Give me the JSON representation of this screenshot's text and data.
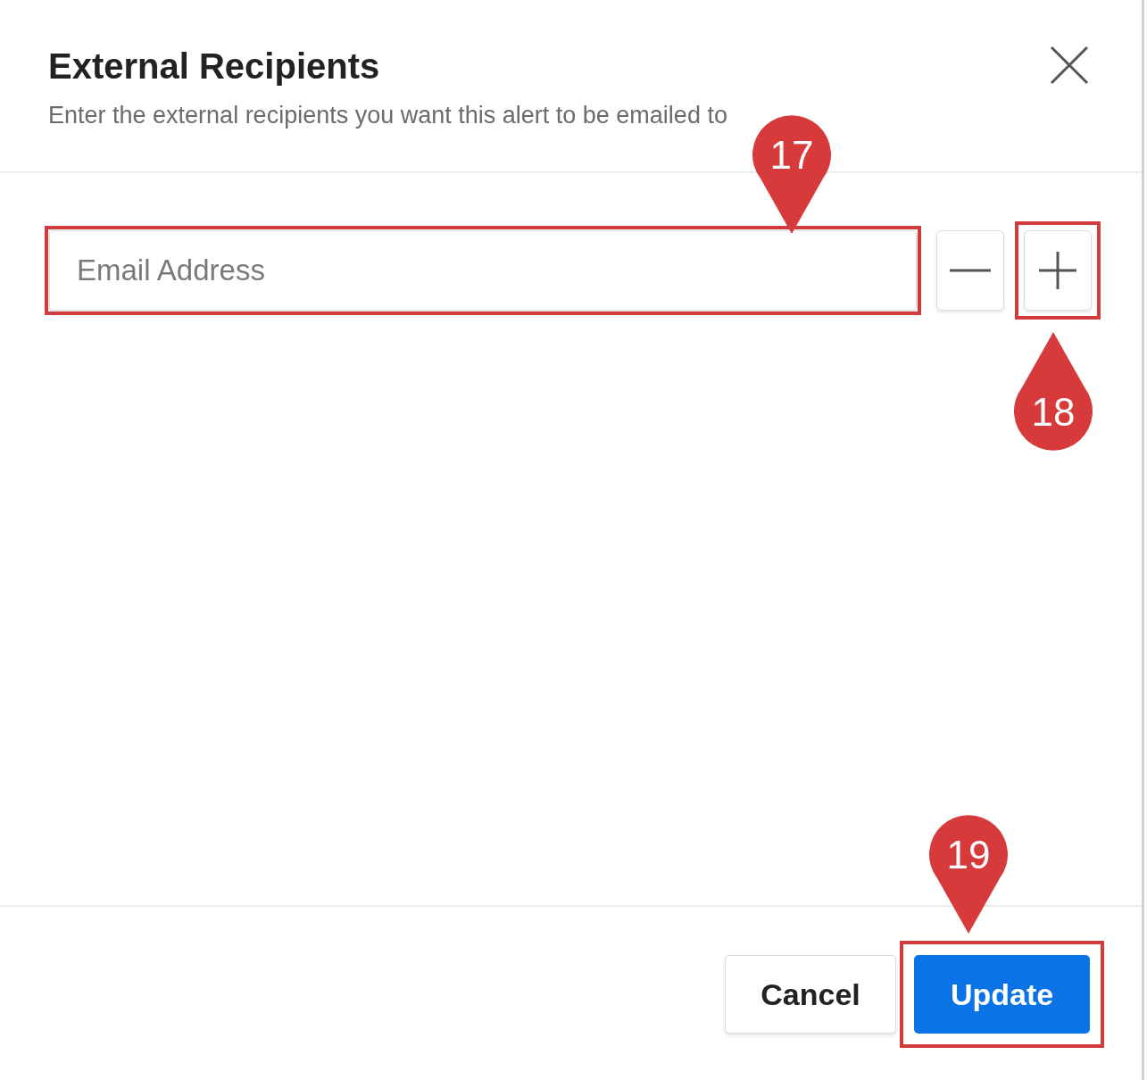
{
  "dialog": {
    "title": "External Recipients",
    "subtitle": "Enter the external recipients you want this alert to be emailed to",
    "email_field": {
      "placeholder": "Email Address"
    },
    "buttons": [
      {
        "label": "Cancel",
        "kind": "secondary"
      },
      {
        "label": "Update",
        "kind": "primary"
      }
    ]
  },
  "annotations": [
    {
      "label": "17",
      "kind": "below"
    },
    {
      "label": "18",
      "kind": "above"
    },
    {
      "label": "19",
      "kind": "below"
    }
  ]
}
